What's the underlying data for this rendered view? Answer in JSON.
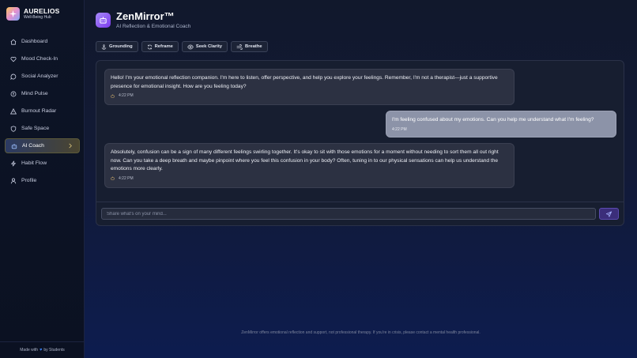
{
  "brand": {
    "name": "AURELIOS",
    "subtitle": "Well-Being Hub"
  },
  "nav": [
    {
      "label": "Dashboard",
      "icon": "home-icon"
    },
    {
      "label": "Mood Check-In",
      "icon": "heart-icon"
    },
    {
      "label": "Social Analyzer",
      "icon": "chat-icon"
    },
    {
      "label": "Mind Pulse",
      "icon": "pulse-icon"
    },
    {
      "label": "Burnout Radar",
      "icon": "warning-icon"
    },
    {
      "label": "Safe Space",
      "icon": "shield-icon"
    },
    {
      "label": "AI Coach",
      "icon": "bot-icon",
      "active": true
    },
    {
      "label": "Habit Flow",
      "icon": "bolt-icon"
    },
    {
      "label": "Profile",
      "icon": "user-icon"
    }
  ],
  "footer": {
    "prefix": "Made with",
    "suffix": "by Students"
  },
  "header": {
    "title": "ZenMirror™",
    "subtitle": "AI Reflection & Emotional Coach"
  },
  "actions": [
    {
      "label": "Grounding",
      "icon": "anchor-icon"
    },
    {
      "label": "Reframe",
      "icon": "refresh-icon"
    },
    {
      "label": "Seek Clarity",
      "icon": "eye-icon"
    },
    {
      "label": "Breathe",
      "icon": "wind-icon"
    }
  ],
  "messages": [
    {
      "role": "ai",
      "text": "Hello! I'm your emotional reflection companion. I'm here to listen, offer perspective, and help you explore your feelings. Remember, I'm not a therapist—just a supportive presence for emotional insight. How are you feeling today?",
      "time": "4:22 PM"
    },
    {
      "role": "user",
      "text": "I'm feeling confused about my emotions. Can you help me understand what I'm feeling?",
      "time": "4:22 PM"
    },
    {
      "role": "ai",
      "text": "Absolutely, confusion can be a sign of many different feelings swirling together. It's okay to sit with those emotions for a moment without needing to sort them all out right now. Can you take a deep breath and maybe pinpoint where you feel this confusion in your body? Often, tuning in to our physical sensations can help us understand the emotions more clearly.",
      "time": "4:22 PM"
    }
  ],
  "input": {
    "placeholder": "Share what's on your mind...",
    "value": ""
  },
  "disclaimer": "ZenMirror offers emotional reflection and support, not professional therapy. If you're in crisis, please contact a mental health professional.",
  "colors": {
    "accent": "#7c3aed",
    "active_nav": "#2b3a63",
    "user_bubble": "#8c93a8",
    "ai_bubble": "#2c3142"
  }
}
